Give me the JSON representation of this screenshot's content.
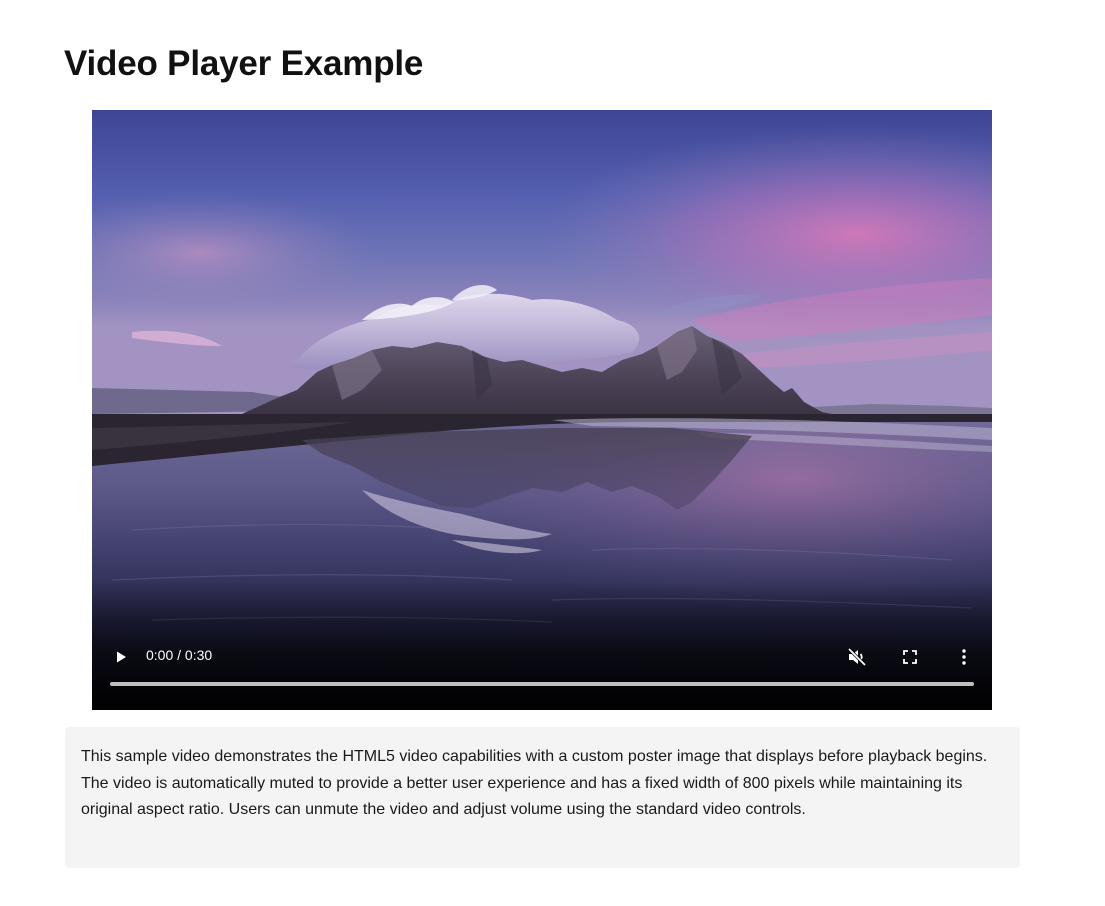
{
  "page": {
    "title": "Video Player Example"
  },
  "video": {
    "time_display": "0:00 / 0:30",
    "current_time": "0:00",
    "duration": "0:30",
    "progress": 0,
    "muted": true,
    "controls": {
      "play_icon": "play-icon",
      "mute_icon": "volume-muted-icon",
      "fullscreen_icon": "fullscreen-icon",
      "more_icon": "more-vertical-icon"
    },
    "colors": {
      "controls": "#ffffff",
      "progress_track": "#c8c8c8"
    }
  },
  "description": {
    "text": "This sample video demonstrates the HTML5 video capabilities with a custom poster image that displays before playback begins. The video is automatically muted to provide a better user experience and has a fixed width of 800 pixels while maintaining its original aspect ratio. Users can unmute the video and adjust volume using the standard video controls."
  }
}
